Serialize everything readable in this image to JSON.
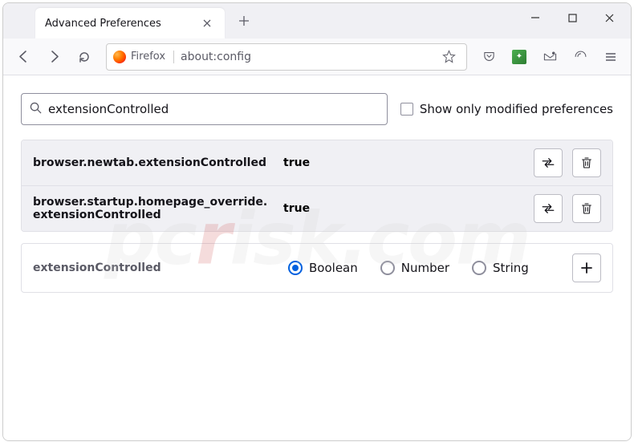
{
  "window": {
    "tab_title": "Advanced Preferences",
    "newtab": "+",
    "minimize": "−",
    "maximize": "□",
    "close": "×"
  },
  "toolbar": {
    "back": "←",
    "forward": "→",
    "reload": "⟳",
    "identity_label": "Firefox",
    "url": "about:config",
    "bookmark": "☆"
  },
  "search": {
    "value": "extensionControlled",
    "show_modified_label": "Show only modified preferences"
  },
  "prefs": [
    {
      "name": "browser.newtab.extensionControlled",
      "value": "true"
    },
    {
      "name": "browser.startup.homepage_override.extensionControlled",
      "value": "true"
    }
  ],
  "new_pref": {
    "name": "extensionControlled",
    "types": [
      "Boolean",
      "Number",
      "String"
    ],
    "selected_index": 0
  },
  "watermark": "pcrisk.com"
}
